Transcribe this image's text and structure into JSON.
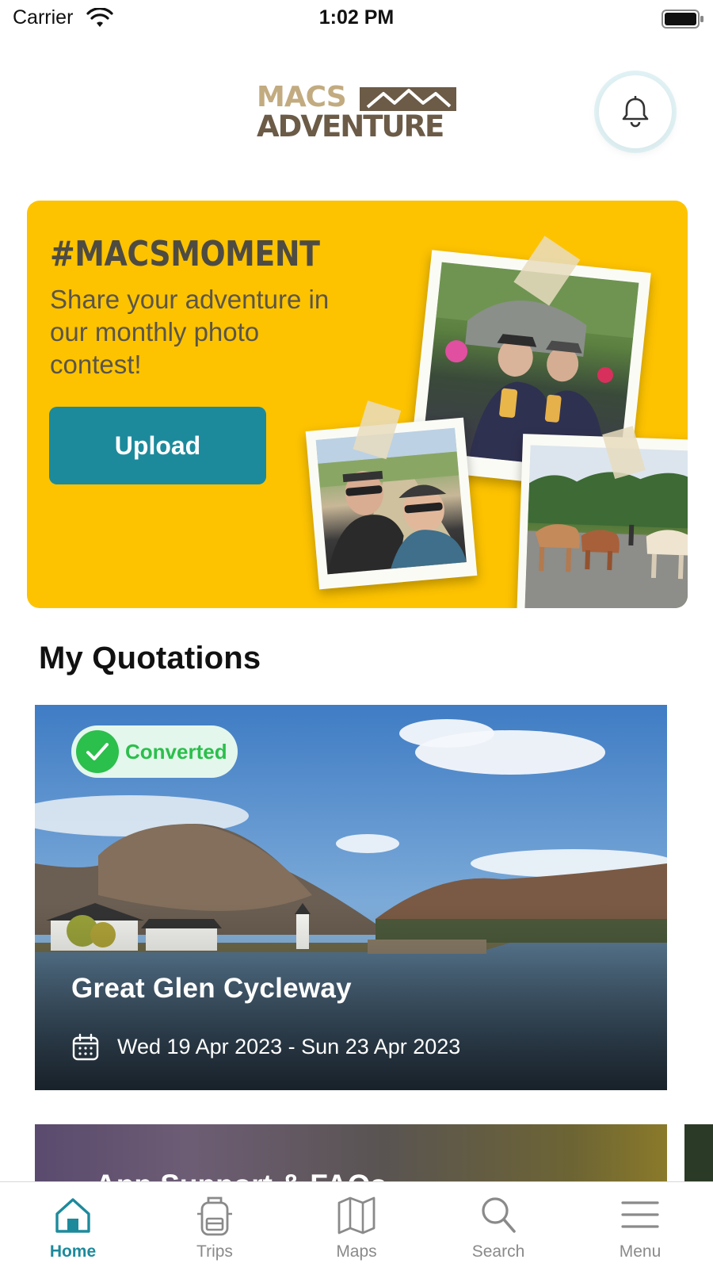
{
  "status_bar": {
    "carrier": "Carrier",
    "time": "1:02 PM"
  },
  "header": {
    "logo_line1": "MACS",
    "logo_line2": "ADVENTURE",
    "bell_icon": "bell-icon"
  },
  "promo": {
    "hashtag": "#MACSMOMENT",
    "text": "Share your adventure in our monthly photo contest!",
    "upload_label": "Upload",
    "background_color": "#fdc300",
    "button_color": "#1d8a9c"
  },
  "quotations": {
    "section_title": "My Quotations",
    "items": [
      {
        "status": "Converted",
        "status_color": "#2bbf4b",
        "title": "Great Glen Cycleway",
        "dates": "Wed 19 Apr 2023 - Sun 23 Apr 2023"
      }
    ]
  },
  "support_card": {
    "title": "App Support & FAQs"
  },
  "tab_bar": {
    "accent_color": "#1d8a9c",
    "tabs": [
      {
        "label": "Home",
        "icon": "home-icon",
        "active": true
      },
      {
        "label": "Trips",
        "icon": "backpack-icon",
        "active": false
      },
      {
        "label": "Maps",
        "icon": "map-icon",
        "active": false
      },
      {
        "label": "Search",
        "icon": "search-icon",
        "active": false
      },
      {
        "label": "Menu",
        "icon": "menu-icon",
        "active": false
      }
    ]
  }
}
